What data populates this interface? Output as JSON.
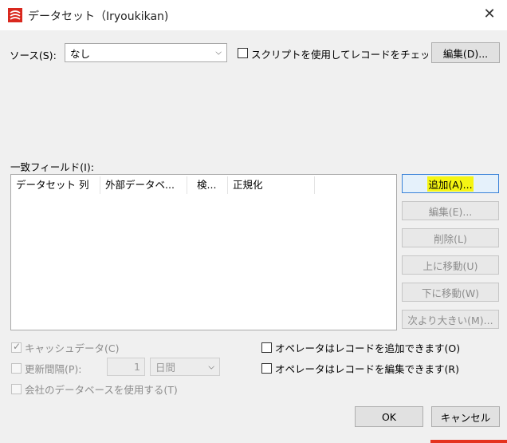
{
  "window": {
    "title": "データセット（Iryoukikan)",
    "icon": "app-logo-icon",
    "close_symbol": "✕"
  },
  "source": {
    "label": "ソース(S):",
    "value": "なし",
    "script_check_label": "スクリプトを使用してレコードをチェック(H",
    "edit_button": "編集(D)..."
  },
  "match_fields": {
    "label": "一致フィールド(I):",
    "columns": [
      "データセット 列",
      "外部データベ...",
      "検...",
      "正規化"
    ],
    "buttons": {
      "add": "追加(A)...",
      "edit": "編集(E)...",
      "delete": "削除(L)",
      "move_up": "上に移動(U)",
      "move_down": "下に移動(W)",
      "greater_than": "次より大きい(M)..."
    }
  },
  "options": {
    "cache_data": "キャッシュデータ(C)",
    "cache_data_checked": true,
    "refresh_interval": "更新間隔(P):",
    "refresh_value": "1",
    "refresh_unit": "日間",
    "use_company_db": "会社のデータベースを使用する(T)",
    "operator_add": "オペレータはレコードを追加できます(O)",
    "operator_edit": "オペレータはレコードを編集できます(R)"
  },
  "footer": {
    "ok": "OK",
    "cancel": "キャンセル"
  },
  "colors": {
    "highlight": "#f5f513",
    "accent": "#e5321f",
    "focus_border": "#3a82d8"
  }
}
